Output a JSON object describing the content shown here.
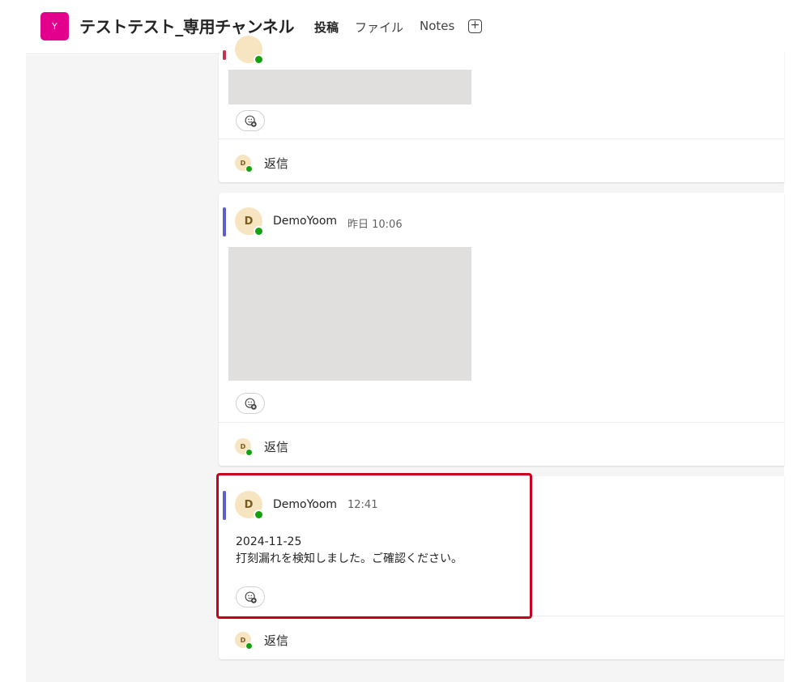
{
  "header": {
    "team_avatar_letter": "Y",
    "channel_title": "テストテスト_専用チャンネル",
    "tabs": [
      {
        "label": "投稿",
        "active": true
      },
      {
        "label": "ファイル",
        "active": false
      },
      {
        "label": "Notes",
        "active": false
      }
    ],
    "add_tab_icon": "plus-square-icon"
  },
  "colors": {
    "team_avatar": "#e3008c",
    "accent_blue": "#5b5fc7",
    "accent_red": "#c4314b",
    "presence_available": "#13a10e",
    "highlight_box": "#c8001e"
  },
  "messages": [
    {
      "reply_avatar_letter": "D",
      "reply_label": "返信"
    },
    {
      "avatar_letter": "D",
      "sender": "DemoYoom",
      "time": "昨日 10:06",
      "reply_avatar_letter": "D",
      "reply_label": "返信"
    },
    {
      "avatar_letter": "D",
      "sender": "DemoYoom",
      "time": "12:41",
      "text_line1": "2024-11-25",
      "text_line2": "打刻漏れを検知しました。ご確認ください。",
      "reply_avatar_letter": "D",
      "reply_label": "返信"
    }
  ]
}
